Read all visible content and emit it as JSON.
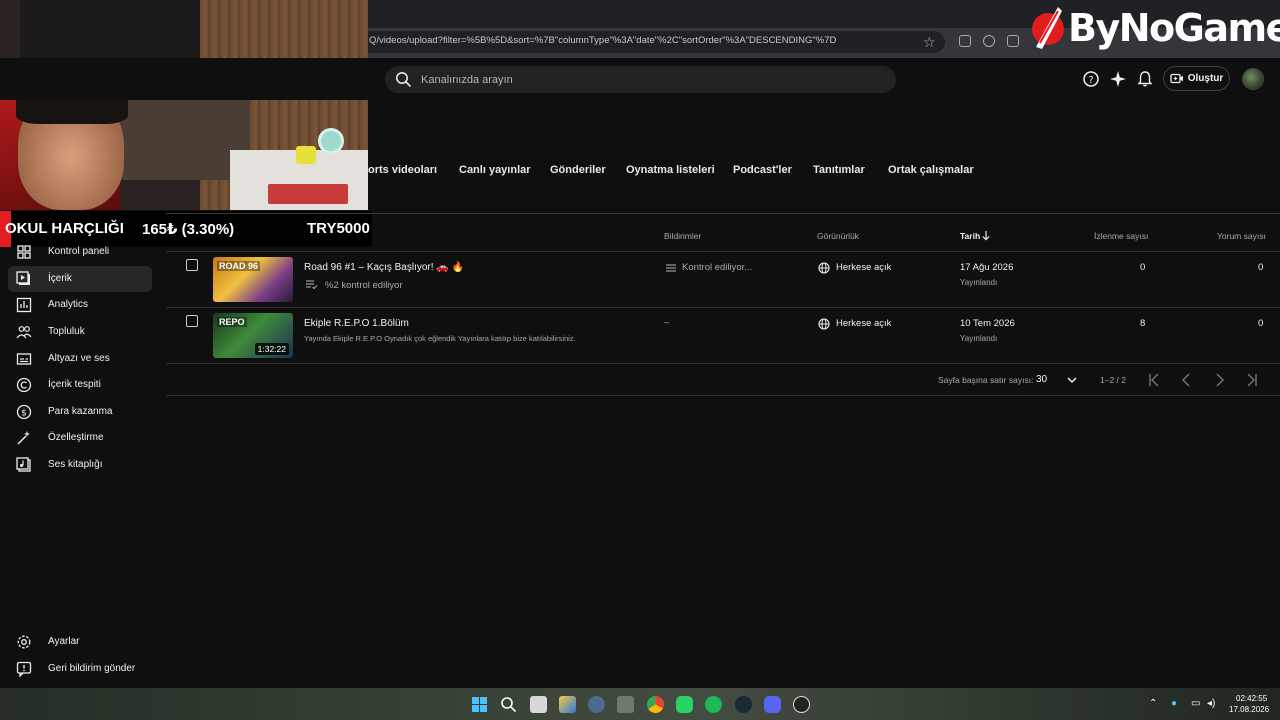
{
  "browser": {
    "url": "Q/videos/upload?filter=%5B%5D&sort=%7B\"columnType\"%3A\"date\"%2C\"sortOrder\"%3A\"DESCENDING\"%7D"
  },
  "overlay": {
    "logo_text": "ByNoGame",
    "ticker_title": "OKUL HARÇLIĞI",
    "ticker_value": "165₺ (3.30%)",
    "ticker_goal": "TRY5000"
  },
  "header": {
    "search_placeholder": "Kanalınızda arayın",
    "create_label": "Oluştur"
  },
  "tabs": [
    {
      "label": "orts videoları"
    },
    {
      "label": "Canlı yayınlar"
    },
    {
      "label": "Gönderiler"
    },
    {
      "label": "Oynatma listeleri"
    },
    {
      "label": "Podcast'ler"
    },
    {
      "label": "Tanıtımlar"
    },
    {
      "label": "Ortak çalışmalar"
    }
  ],
  "sidebar": {
    "items": [
      {
        "label": "Kontrol paneli",
        "icon": "dashboard-icon"
      },
      {
        "label": "İçerik",
        "icon": "content-icon",
        "active": true
      },
      {
        "label": "Analytics",
        "icon": "analytics-icon"
      },
      {
        "label": "Topluluk",
        "icon": "community-icon"
      },
      {
        "label": "Altyazı ve ses",
        "icon": "subtitles-icon"
      },
      {
        "label": "İçerik tespiti",
        "icon": "copyright-icon"
      },
      {
        "label": "Para kazanma",
        "icon": "monetization-icon"
      },
      {
        "label": "Özelleştirme",
        "icon": "customization-icon"
      },
      {
        "label": "Ses kitaplığı",
        "icon": "audio-library-icon"
      }
    ],
    "bottom": [
      {
        "label": "Ayarlar",
        "icon": "settings-icon"
      },
      {
        "label": "Geri bildirim gönder",
        "icon": "feedback-icon"
      }
    ]
  },
  "table": {
    "headers": {
      "notifications": "Bildirimler",
      "visibility": "Görünürlük",
      "date": "Tarih",
      "views": "İzlenme sayısı",
      "comments": "Yorum sayısı"
    },
    "rows": [
      {
        "title": "Road 96 #1 – Kaçış Başlıyor! 🚗 🔥",
        "subtitle": "%2 kontrol ediliyor",
        "thumb_text": "ROAD 96",
        "duration": "",
        "notifications": "Kontrol ediliyor...",
        "visibility": "Herkese açık",
        "date": "17 Ağu 2026",
        "status": "Yayınlandı",
        "views": "0",
        "comments": "0"
      },
      {
        "title": "Ekiple R.E.P.O 1.Bölüm",
        "subtitle": "Yayında Ekiple R.E.P.O Oynadık çok eğlendik Yayınlara katılıp bize katılabilirsiniz.",
        "thumb_text": "REPO",
        "duration": "1:32:22",
        "notifications": "–",
        "visibility": "Herkese açık",
        "date": "10 Tem 2026",
        "status": "Yayınlandı",
        "views": "8",
        "comments": "0"
      }
    ]
  },
  "pagination": {
    "rows_label": "Sayfa başına satır sayısı:",
    "rows_value": "30",
    "range": "1–2 / 2"
  },
  "taskbar": {
    "time": "02:42:55",
    "date": "17.08.2026"
  }
}
